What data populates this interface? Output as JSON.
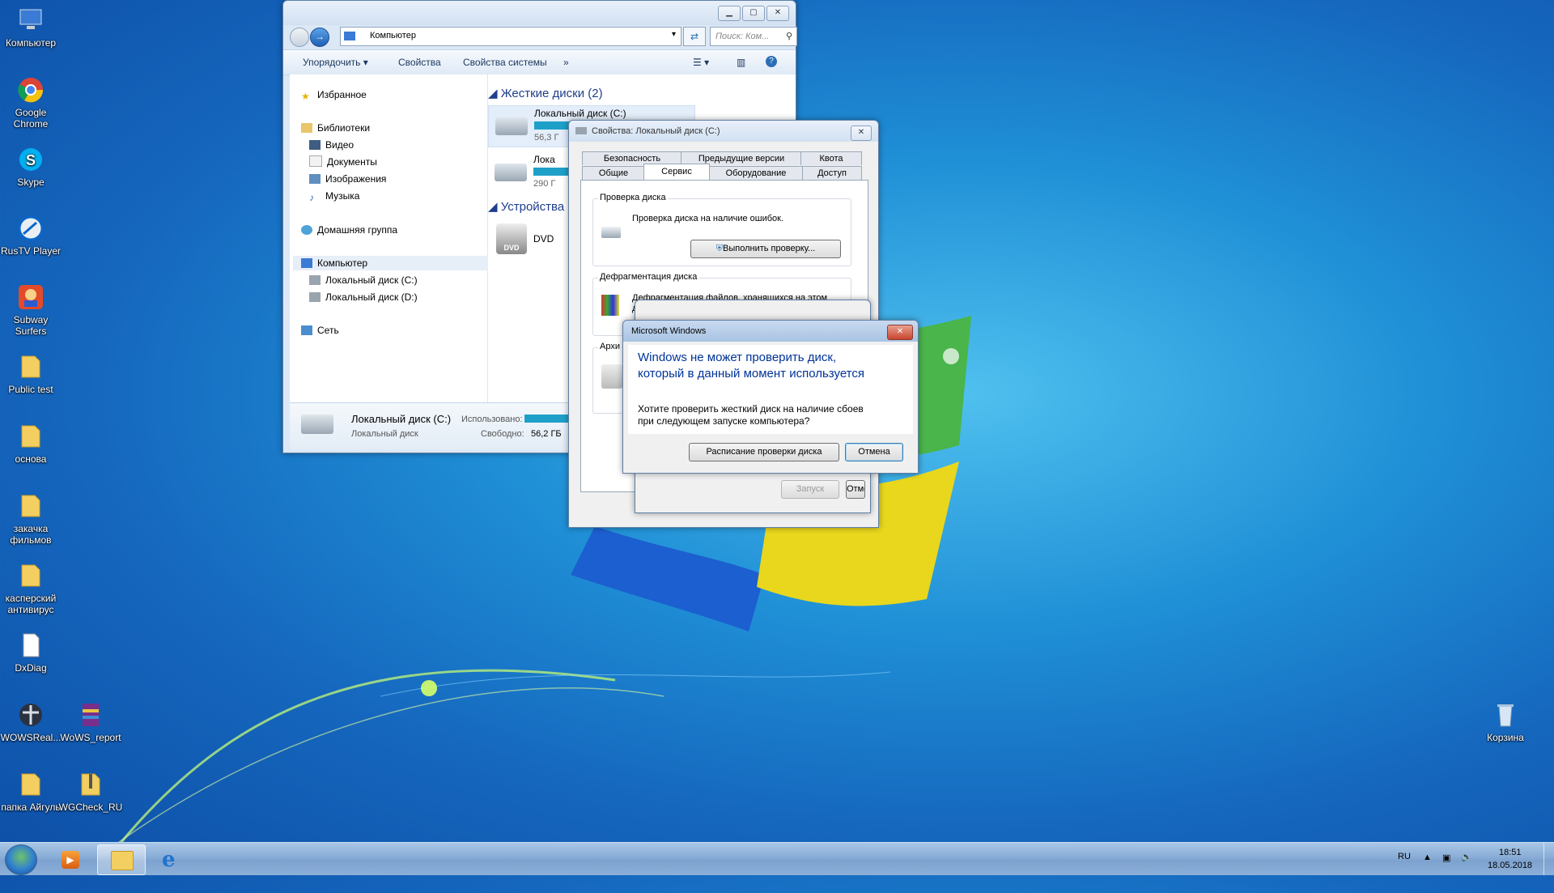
{
  "desktop": {
    "icons": [
      {
        "label": "Компьютер",
        "icon": "computer-icon"
      },
      {
        "label": "Google Chrome",
        "icon": "chrome-icon"
      },
      {
        "label": "Skype",
        "icon": "skype-icon"
      },
      {
        "label": "RusTV Player",
        "icon": "rustv-icon"
      },
      {
        "label": "Subway Surfers",
        "icon": "subway-surfers-icon"
      },
      {
        "label": "Public test",
        "icon": "folder-icon"
      },
      {
        "label": "основа",
        "icon": "folder-icon"
      },
      {
        "label": "закачка фильмов",
        "icon": "folder-icon"
      },
      {
        "label": "касперский антивирус",
        "icon": "folder-icon"
      },
      {
        "label": "DxDiag",
        "icon": "document-icon"
      },
      {
        "label": "WOWSReal...",
        "icon": "wows-icon"
      },
      {
        "label": "WoWS_report",
        "icon": "archive-icon"
      },
      {
        "label": "папка Айгуль",
        "icon": "folder-icon"
      },
      {
        "label": "WGCheck_RU",
        "icon": "folder-zip-icon"
      },
      {
        "label": "Корзина",
        "icon": "recycle-bin-icon"
      }
    ]
  },
  "explorer": {
    "address": "Компьютер",
    "search_placeholder": "Поиск: Ком...",
    "toolbar": {
      "organize": "Упорядочить",
      "properties": "Свойства",
      "system_properties": "Свойства системы",
      "more": "»"
    },
    "nav": {
      "favorites": "Избранное",
      "libraries": "Библиотеки",
      "video": "Видео",
      "documents": "Документы",
      "images": "Изображения",
      "music": "Музыка",
      "homegroup": "Домашняя группа",
      "computer": "Компьютер",
      "disk_c": "Локальный диск (C:)",
      "disk_d": "Локальный диск (D:)",
      "network": "Сеть"
    },
    "groups": {
      "hard_disks": "Жесткие диски (2)",
      "devices": "Устройства"
    },
    "drives": {
      "c_name": "Локальный диск (C:)",
      "c_free": "56,3 Г",
      "d_name": "Лока",
      "d_free": "290 Г",
      "dvd": "DVD",
      "dvd_badge": "DVD"
    },
    "details": {
      "name": "Локальный диск (C:)",
      "type": "Локальный диск",
      "used_label": "Использовано:",
      "free_label": "Свободно:",
      "free_value": "56,2 ГБ"
    }
  },
  "properties": {
    "title": "Свойства: Локальный диск (C:)",
    "tabs_row1": [
      "Безопасность",
      "Предыдущие версии",
      "Квота"
    ],
    "tabs_row2": [
      "Общие",
      "Сервис",
      "Оборудование",
      "Доступ"
    ],
    "check_group": "Проверка диска",
    "check_text": "Проверка диска на наличие ошибок.",
    "check_button": "Выполнить проверку...",
    "defrag_group": "Дефрагментация диска",
    "defrag_text": "Дефрагментация файлов, хранящихся на этом диске.",
    "archive_group": "Архи"
  },
  "check_dialog": {
    "start_button": "Запуск",
    "cancel_button": "Отмена"
  },
  "message_box": {
    "title": "Microsoft Windows",
    "heading": "Windows не может проверить диск, который в данный момент используется",
    "body": "Хотите проверить жесткий диск на наличие сбоев при следующем запуске компьютера?",
    "schedule_button": "Расписание проверки диска",
    "cancel_button": "Отмена"
  },
  "taskbar": {
    "lang": "RU",
    "time": "18:51",
    "date": "18.05.2018"
  }
}
